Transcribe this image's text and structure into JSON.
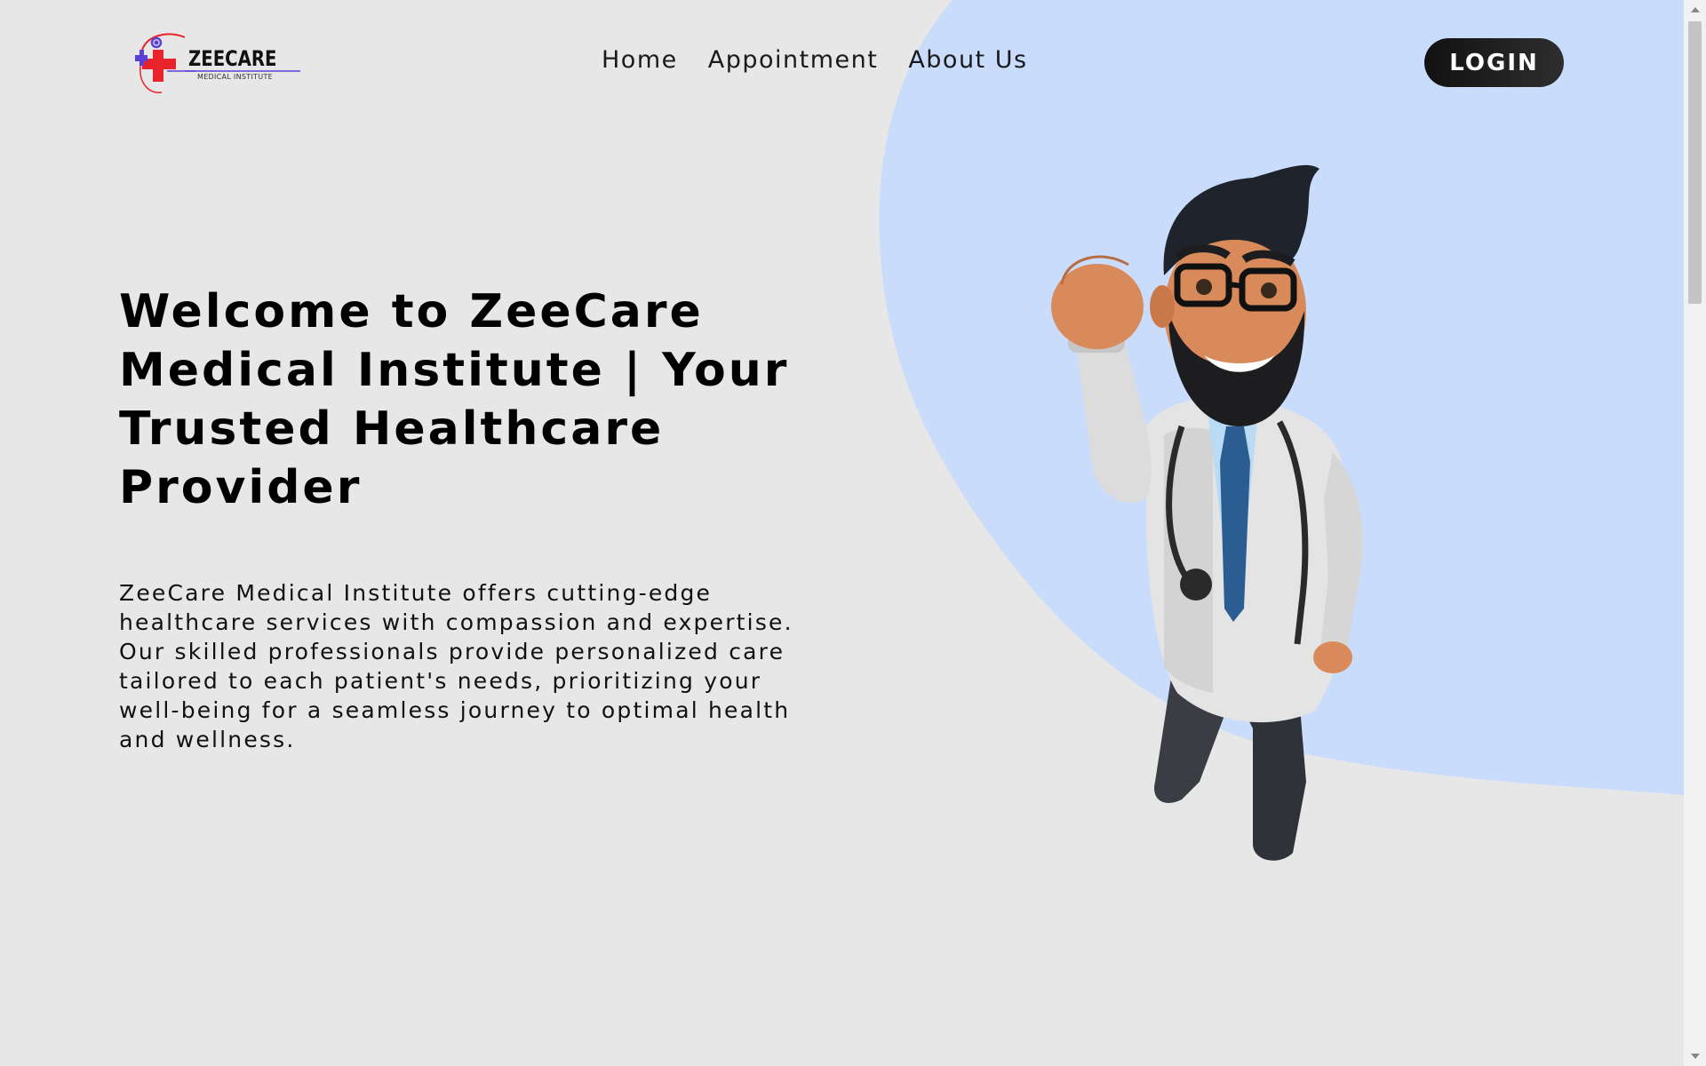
{
  "brand": {
    "name": "ZEECARE",
    "subtitle": "MEDICAL INSTITUTE"
  },
  "nav": {
    "links": [
      "Home",
      "Appointment",
      "About Us"
    ],
    "login_label": "LOGIN"
  },
  "hero": {
    "title": "Welcome to ZeeCare Medical Institute | Your Trusted Healthcare Provider",
    "description": "ZeeCare Medical Institute offers cutting-edge healthcare services with compassion and expertise. Our skilled professionals provide personalized care tailored to each patient's needs, prioritizing your well-being for a seamless journey to optimal health and wellness."
  },
  "colors": {
    "background": "#e7e7e7",
    "accent_blob": "#c9dcfb",
    "button": "#111111",
    "logo_red": "#e8232b",
    "logo_purple": "#5b3fd6"
  },
  "icons": {
    "logo": "medical-cross-logo",
    "hero_image": "doctor-illustration"
  }
}
